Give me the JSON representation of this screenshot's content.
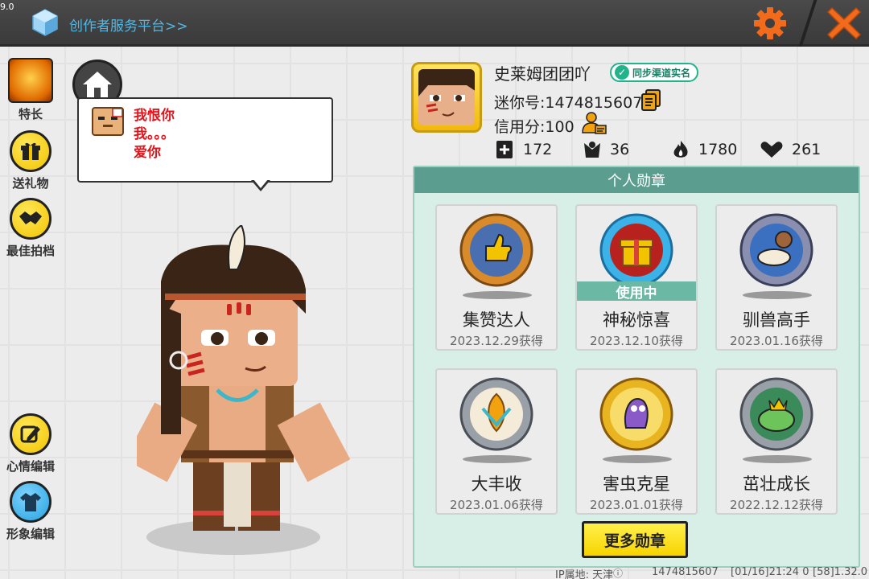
{
  "topbar": {
    "version": "9.0",
    "creator_link": "创作者服务平台>>",
    "settings_icon": "gear-icon",
    "close_icon": "close-icon",
    "accent": "#f26b1d"
  },
  "sidebar": {
    "items": [
      {
        "label": "特长",
        "icon": "talent-icon"
      },
      {
        "label": "送礼物",
        "icon": "gift-icon"
      },
      {
        "label": "最佳拍档",
        "icon": "handshake-icon"
      },
      {
        "label": "心情编辑",
        "icon": "edit-icon"
      },
      {
        "label": "形象编辑",
        "icon": "outfit-icon"
      }
    ]
  },
  "bubble": {
    "text": "我恨你\n我。。。\n爱你"
  },
  "profile": {
    "nickname": "史莱姆团团吖",
    "realname_badge": "同步渠道实名",
    "mini_id": "迷你号:1474815607",
    "credit": "信用分:100",
    "stats": {
      "additions": "172",
      "fans": "36",
      "popularity": "1780",
      "likes": "261"
    }
  },
  "medals": {
    "title": "个人勋章",
    "in_use_label": "使用中",
    "more_button": "更多勋章",
    "items": [
      {
        "name": "集赞达人",
        "date": "2023.12.29获得",
        "in_use": false,
        "color": "#d98a2a"
      },
      {
        "name": "神秘惊喜",
        "date": "2023.12.10获得",
        "in_use": true,
        "color": "#3bb3e8"
      },
      {
        "name": "驯兽高手",
        "date": "2023.01.16获得",
        "in_use": false,
        "color": "#8a8fb0"
      },
      {
        "name": "大丰收",
        "date": "2023.01.06获得",
        "in_use": false,
        "color": "#9aa0a8"
      },
      {
        "name": "害虫克星",
        "date": "2023.01.01获得",
        "in_use": false,
        "color": "#e8b420"
      },
      {
        "name": "茁壮成长",
        "date": "2022.12.12获得",
        "in_use": false,
        "color": "#9aa0a8"
      }
    ]
  },
  "footer": {
    "ip": "IP属地: 天津",
    "uid": "1474815607",
    "time": "[01/16]21:24 0",
    "build": "[58]1.32.0"
  }
}
